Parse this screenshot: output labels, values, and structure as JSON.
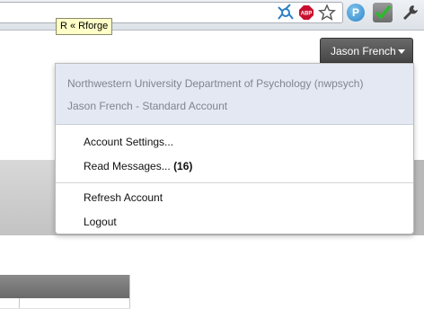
{
  "browser": {
    "tooltip_text": "R « Rforge",
    "extensions": [
      "network-icon",
      "adblock-plus-icon",
      "star-icon",
      "p-extension-icon",
      "checkmark-extension-icon",
      "wrench-icon"
    ],
    "abp_label": "ABP",
    "p_label": "P"
  },
  "user_menu": {
    "button_label": "Jason French",
    "organization": "Northwestern University Department of Psychology (nwpsych)",
    "account": "Jason French - Standard Account",
    "items": {
      "account_settings": "Account Settings...",
      "read_messages": "Read Messages...",
      "read_messages_count": "(16)",
      "refresh_account": "Refresh Account",
      "logout": "Logout"
    }
  }
}
